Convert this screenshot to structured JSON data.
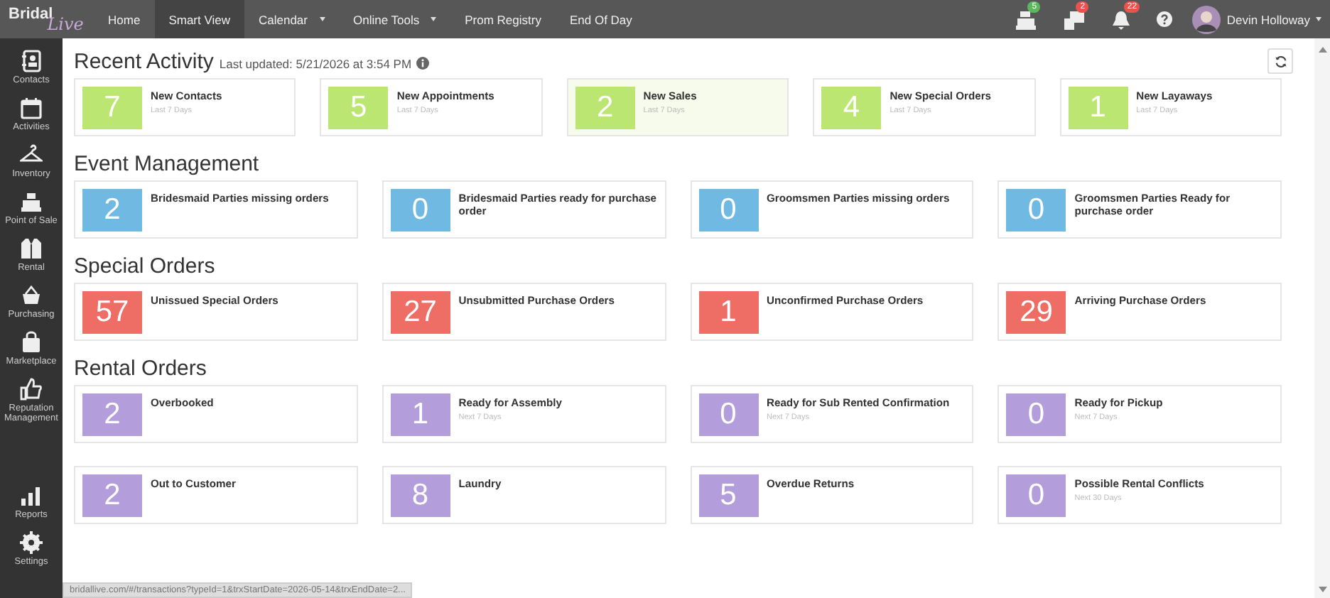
{
  "logo": {
    "word": "Bridal",
    "script": "Live"
  },
  "nav": [
    {
      "label": "Home",
      "selected": false,
      "has_menu": false
    },
    {
      "label": "Smart View",
      "selected": true,
      "has_menu": false
    },
    {
      "label": "Calendar",
      "selected": false,
      "has_menu": true
    },
    {
      "label": "Online Tools",
      "selected": false,
      "has_menu": true
    },
    {
      "label": "Prom Registry",
      "selected": false,
      "has_menu": false
    },
    {
      "label": "End Of Day",
      "selected": false,
      "has_menu": false
    }
  ],
  "notifications": [
    {
      "kind": "register",
      "count": "5",
      "color": "#5cb85c"
    },
    {
      "kind": "monitor",
      "count": "2",
      "color": "#e9534f"
    },
    {
      "kind": "bell",
      "count": "22",
      "color": "#e9534f"
    }
  ],
  "user": {
    "name": "Devin Holloway"
  },
  "sidebar": {
    "items": [
      {
        "kind": "contacts",
        "label": "Contacts"
      },
      {
        "kind": "calendar",
        "label": "Activities"
      },
      {
        "kind": "hanger",
        "label": "Inventory"
      },
      {
        "kind": "register",
        "label": "Point of Sale"
      },
      {
        "kind": "jacket",
        "label": "Rental"
      },
      {
        "kind": "basket",
        "label": "Purchasing"
      },
      {
        "kind": "bag",
        "label": "Marketplace"
      },
      {
        "kind": "thumb",
        "label": "Reputation Management"
      }
    ],
    "bottom_items": [
      {
        "kind": "chart",
        "label": "Reports"
      },
      {
        "kind": "gear",
        "label": "Settings"
      }
    ]
  },
  "sections": [
    {
      "title": "Recent Activity",
      "updated": "Last updated: 5/21/2026 at 3:54 PM",
      "color": "#bce672",
      "rows": [
        [
          {
            "count": "7",
            "label": "New Contacts",
            "note": "Last 7 Days",
            "highlighted": false
          },
          {
            "count": "5",
            "label": "New Appointments",
            "note": "Last 7 Days",
            "highlighted": false
          },
          {
            "count": "2",
            "label": "New Sales",
            "note": "Last 7 Days",
            "highlighted": true
          },
          {
            "count": "4",
            "label": "New Special Orders",
            "note": "Last 7 Days",
            "highlighted": false
          },
          {
            "count": "1",
            "label": "New Layaways",
            "note": "Last 7 Days",
            "highlighted": false
          }
        ]
      ]
    },
    {
      "title": "Event Management",
      "color": "#6fb9e3",
      "rows": [
        [
          {
            "count": "2",
            "label": "Bridesmaid Parties missing orders",
            "highlighted": false
          },
          {
            "count": "0",
            "label": "Bridesmaid Parties ready for purchase order",
            "highlighted": false
          },
          {
            "count": "0",
            "label": "Groomsmen Parties missing orders",
            "highlighted": false
          },
          {
            "count": "0",
            "label": "Groomsmen Parties Ready for purchase order",
            "highlighted": false
          }
        ]
      ]
    },
    {
      "title": "Special Orders",
      "color": "#ee6e66",
      "rows": [
        [
          {
            "count": "57",
            "label": "Unissued Special Orders",
            "highlighted": false
          },
          {
            "count": "27",
            "label": "Unsubmitted Purchase Orders",
            "highlighted": false
          },
          {
            "count": "1",
            "label": "Unconfirmed Purchase Orders",
            "highlighted": false
          },
          {
            "count": "29",
            "label": "Arriving Purchase Orders",
            "highlighted": false
          }
        ]
      ]
    },
    {
      "title": "Rental Orders",
      "color": "#b39ddb",
      "rows": [
        [
          {
            "count": "2",
            "label": "Overbooked",
            "highlighted": false
          },
          {
            "count": "1",
            "label": "Ready for Assembly",
            "note": "Next 7 Days",
            "highlighted": false
          },
          {
            "count": "0",
            "label": "Ready for Sub Rented Confirmation",
            "note": "Next 7 Days",
            "highlighted": false
          },
          {
            "count": "0",
            "label": "Ready for Pickup",
            "note": "Next 7 Days",
            "highlighted": false
          }
        ],
        [
          {
            "count": "2",
            "label": "Out to Customer",
            "highlighted": false
          },
          {
            "count": "8",
            "label": "Laundry",
            "highlighted": false
          },
          {
            "count": "5",
            "label": "Overdue Returns",
            "highlighted": false
          },
          {
            "count": "0",
            "label": "Possible Rental Conflicts",
            "note": "Next 30 Days",
            "highlighted": false
          }
        ]
      ]
    }
  ],
  "status_bar": "bridallive.com/#/transactions?typeId=1&trxStartDate=2026-05-14&trxEndDate=2..."
}
